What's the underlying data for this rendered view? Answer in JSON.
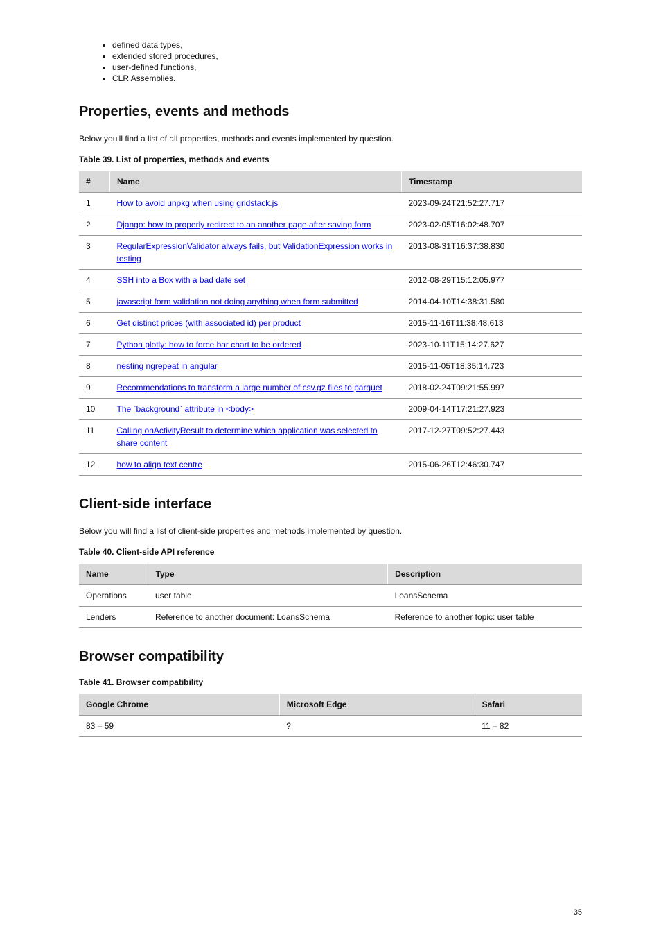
{
  "top_list": [
    "defined data types,",
    "extended stored procedures,",
    "user-defined functions,",
    "CLR Assemblies."
  ],
  "section2": {
    "title": "Properties, events and methods",
    "paragraph": "Below you'll find a list of all properties, methods and events implemented by question.",
    "table_caption": "Table 39. List of properties, methods and events",
    "headers": [
      "#",
      "Name",
      "Timestamp"
    ],
    "rows": [
      {
        "num": "1",
        "link": "How to avoid unpkg when using gridstack.js",
        "ts": "2023-09-24T21:52:27.717"
      },
      {
        "num": "2",
        "link": "Django: how to properly redirect to an another page after saving form",
        "ts": "2023-02-05T16:02:48.707"
      },
      {
        "num": "3",
        "link": "RegularExpressionValidator always fails, but ValidationExpression works in testing",
        "ts": "2013-08-31T16:37:38.830"
      },
      {
        "num": "4",
        "link": "SSH into a Box with a bad date set",
        "ts": "2012-08-29T15:12:05.977"
      },
      {
        "num": "5",
        "link": "javascript form validation not doing anything when form submitted",
        "ts": "2014-04-10T14:38:31.580"
      },
      {
        "num": "6",
        "link": "Get distinct prices (with associated id) per product",
        "ts": "2015-11-16T11:38:48.613"
      },
      {
        "num": "7",
        "link": "Python plotly: how to force bar chart to be ordered",
        "ts": "2023-10-11T15:14:27.627"
      },
      {
        "num": "8",
        "link": "nesting ngrepeat in angular",
        "ts": "2015-11-05T18:35:14.723"
      },
      {
        "num": "9",
        "link": "Recommendations to transform a large number of csv.gz files to parquet",
        "ts": "2018-02-24T09:21:55.997"
      },
      {
        "num": "10",
        "link": "The `background` attribute in <body>",
        "ts": "2009-04-14T17:21:27.923"
      },
      {
        "num": "11",
        "link": "Calling onActivityResult to determine which application was selected to share content",
        "ts": "2017-12-27T09:52:27.443"
      },
      {
        "num": "12",
        "link": "how to align text centre",
        "ts": "2015-06-26T12:46:30.747"
      }
    ]
  },
  "section3": {
    "title": "Client-side interface",
    "paragraph": "Below you will find a list of client-side properties and methods implemented by question.",
    "table_caption": "Table 40. Client-side API reference",
    "headers": [
      "Name",
      "Type",
      "Description"
    ],
    "rows": [
      {
        "name": "Operations",
        "type": "user table",
        "desc": "LoansSchema"
      },
      {
        "name": "Lenders",
        "type": "Reference to another document: LoansSchema",
        "desc": "Reference to another topic: user table"
      }
    ]
  },
  "section4": {
    "title": "Browser compatibility",
    "caption": "Table 41. Browser compatibility",
    "headers": [
      "Google Chrome",
      "Microsoft Edge",
      "Safari"
    ],
    "rows": [
      {
        "c1": "83 – 59",
        "c2": "?",
        "c3": "11 – 82"
      }
    ]
  },
  "page_number": "35"
}
